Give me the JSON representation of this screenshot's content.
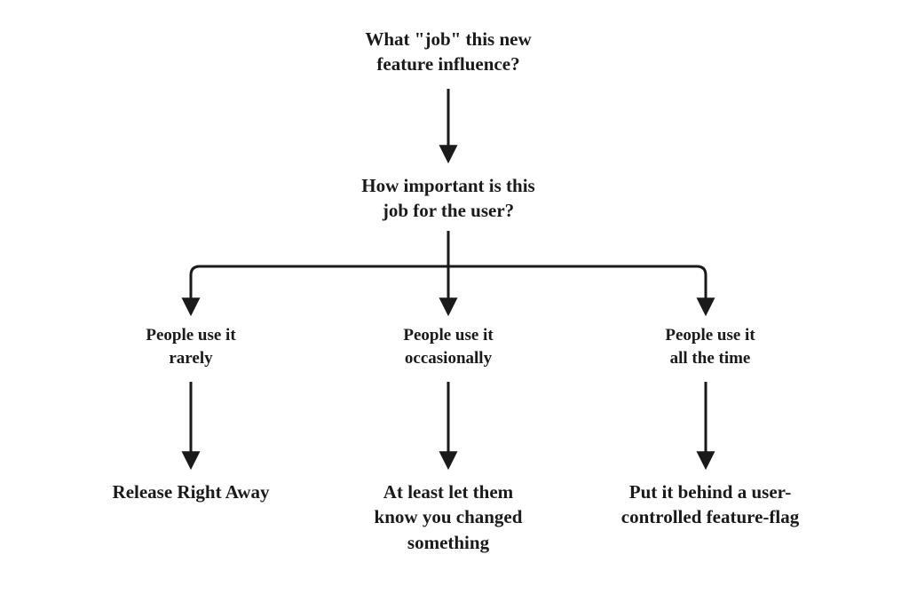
{
  "diagram": {
    "question1": "What \"job\" this new\nfeature influence?",
    "question2": "How important is this\njob for the user?",
    "branch1": {
      "label": "People use it\nrarely",
      "outcome": "Release Right Away"
    },
    "branch2": {
      "label": "People use it\noccasionally",
      "outcome": "At least let them\nknow you changed\nsomething"
    },
    "branch3": {
      "label": "People use it\nall the time",
      "outcome": "Put it behind a user-\ncontrolled feature-flag"
    }
  },
  "style": {
    "stroke": "#1a1a1a"
  }
}
